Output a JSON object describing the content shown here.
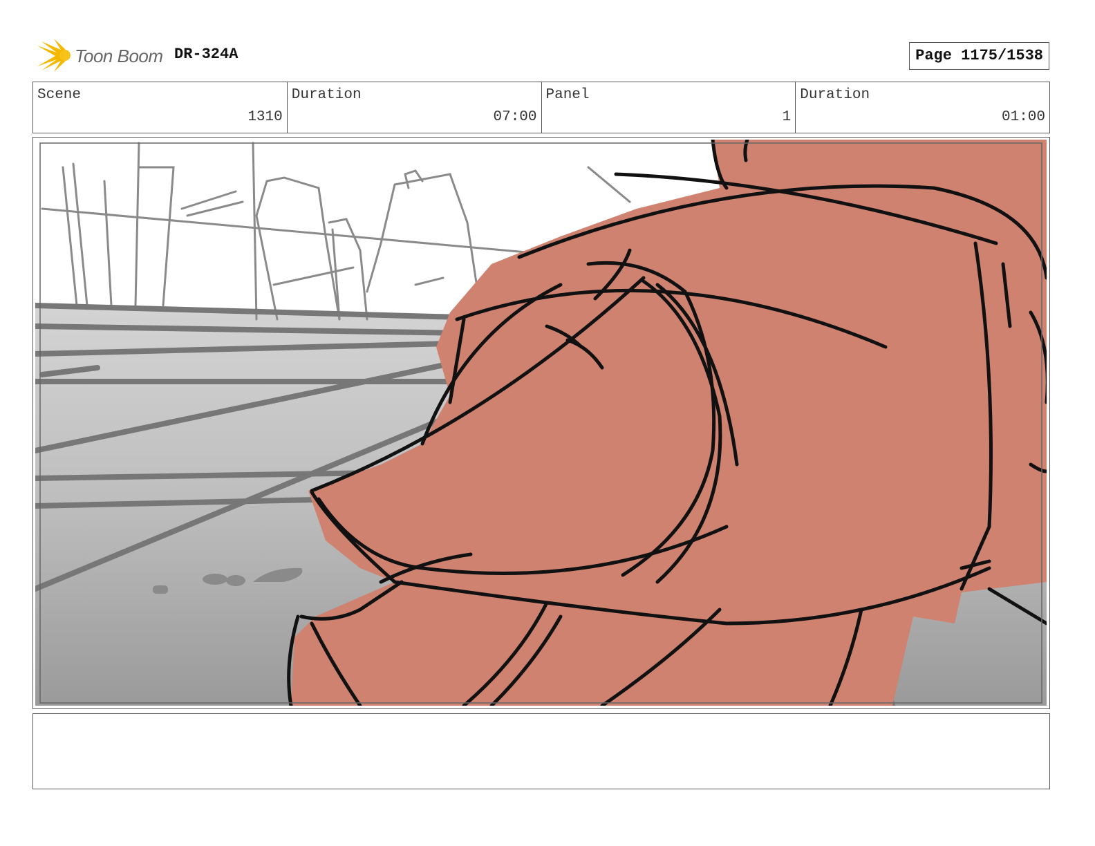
{
  "header": {
    "logo_text": "Toon Boom",
    "production_code": "DR-324A",
    "page_label": "Page 1175/1538"
  },
  "info": {
    "scene_label": "Scene",
    "scene_value": "1310",
    "scene_duration_label": "Duration",
    "scene_duration_value": "07:00",
    "panel_label": "Panel",
    "panel_value": "1",
    "panel_duration_label": "Duration",
    "panel_duration_value": "01:00"
  },
  "colors": {
    "character_fill": "#d08270",
    "logo_yellow": "#f5b800",
    "ground_gray": "#9a9a9a"
  },
  "notes": {
    "text": ""
  }
}
